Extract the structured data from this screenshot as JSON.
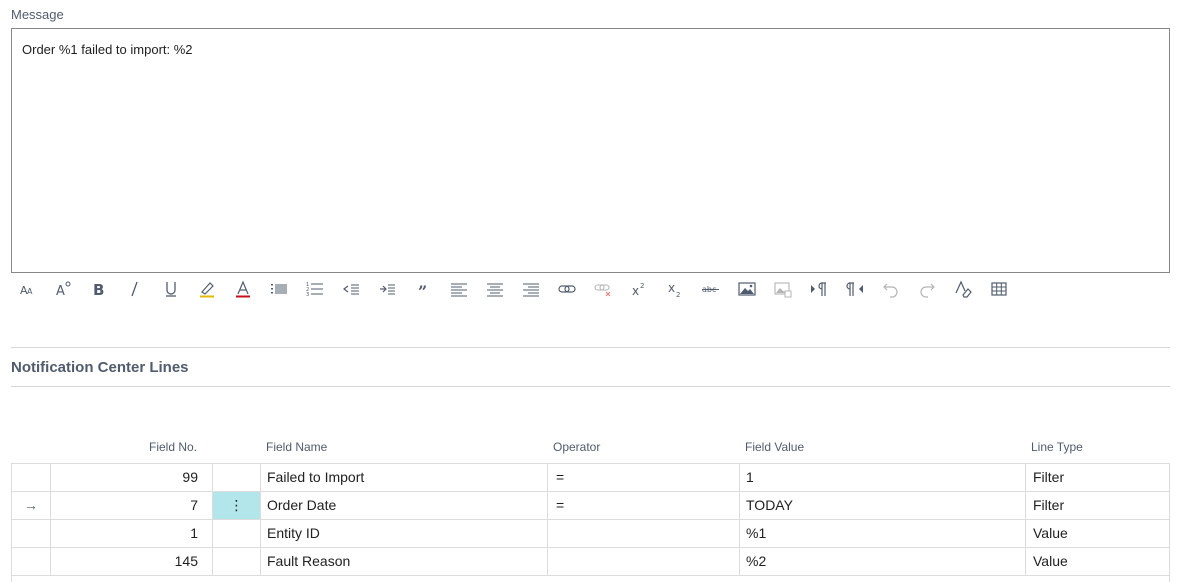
{
  "message": {
    "label": "Message",
    "content": "Order %1 failed to import: %2"
  },
  "toolbar": {
    "buttons": [
      {
        "name": "font-size-icon"
      },
      {
        "name": "font-style-icon"
      },
      {
        "name": "bold-icon"
      },
      {
        "name": "italic-icon"
      },
      {
        "name": "underline-icon"
      },
      {
        "name": "highlight-icon"
      },
      {
        "name": "font-color-icon"
      },
      {
        "name": "bullet-list-icon"
      },
      {
        "name": "numbered-list-icon"
      },
      {
        "name": "decrease-indent-icon"
      },
      {
        "name": "increase-indent-icon"
      },
      {
        "name": "quote-icon"
      },
      {
        "name": "align-left-icon"
      },
      {
        "name": "align-center-icon"
      },
      {
        "name": "align-right-icon"
      },
      {
        "name": "insert-link-icon"
      },
      {
        "name": "remove-link-icon"
      },
      {
        "name": "superscript-icon"
      },
      {
        "name": "subscript-icon"
      },
      {
        "name": "strikethrough-icon"
      },
      {
        "name": "insert-image-icon"
      },
      {
        "name": "image-properties-icon"
      },
      {
        "name": "ltr-paragraph-icon"
      },
      {
        "name": "rtl-paragraph-icon"
      },
      {
        "name": "undo-icon"
      },
      {
        "name": "redo-icon"
      },
      {
        "name": "clear-formatting-icon"
      },
      {
        "name": "insert-table-icon"
      }
    ]
  },
  "lines": {
    "title": "Notification Center Lines",
    "columns": {
      "field_no": "Field No.",
      "field_name": "Field Name",
      "operator": "Operator",
      "field_value": "Field Value",
      "line_type": "Line Type"
    },
    "rows": [
      {
        "indicator": "",
        "field_no": "99",
        "field_name": "Failed to Import",
        "operator": "=",
        "field_value": "1",
        "line_type": "Filter"
      },
      {
        "indicator": "→",
        "menu": "⋮",
        "field_no": "7",
        "field_name": "Order Date",
        "operator": "=",
        "field_value": "TODAY",
        "line_type": "Filter"
      },
      {
        "indicator": "",
        "field_no": "1",
        "field_name": "Entity ID",
        "operator": "",
        "field_value": "%1",
        "line_type": "Value"
      },
      {
        "indicator": "",
        "field_no": "145",
        "field_name": "Fault Reason",
        "operator": "",
        "field_value": "%2",
        "line_type": "Value"
      }
    ]
  }
}
